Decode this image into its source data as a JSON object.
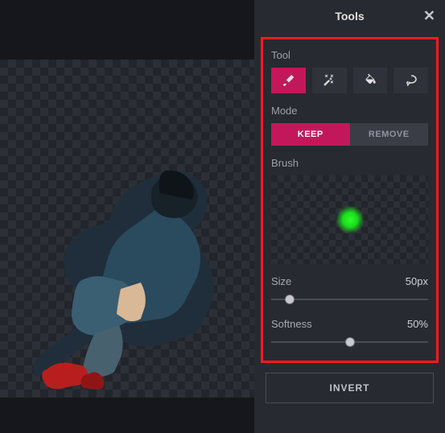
{
  "panel": {
    "title": "Tools",
    "close": "✕"
  },
  "tool": {
    "label": "Tool",
    "icons": [
      "brush-icon",
      "wand-icon",
      "bucket-icon",
      "lasso-icon"
    ]
  },
  "mode": {
    "label": "Mode",
    "keep": "KEEP",
    "remove": "REMOVE"
  },
  "brush": {
    "label": "Brush"
  },
  "size": {
    "label": "Size",
    "value": "50px",
    "percent": 12
  },
  "softness": {
    "label": "Softness",
    "value": "50%",
    "percent": 50
  },
  "invert": "INVERT",
  "colors": {
    "accent": "#c2185b",
    "highlight": "#ff1a1a",
    "brush_preview": "#2bff2b"
  }
}
